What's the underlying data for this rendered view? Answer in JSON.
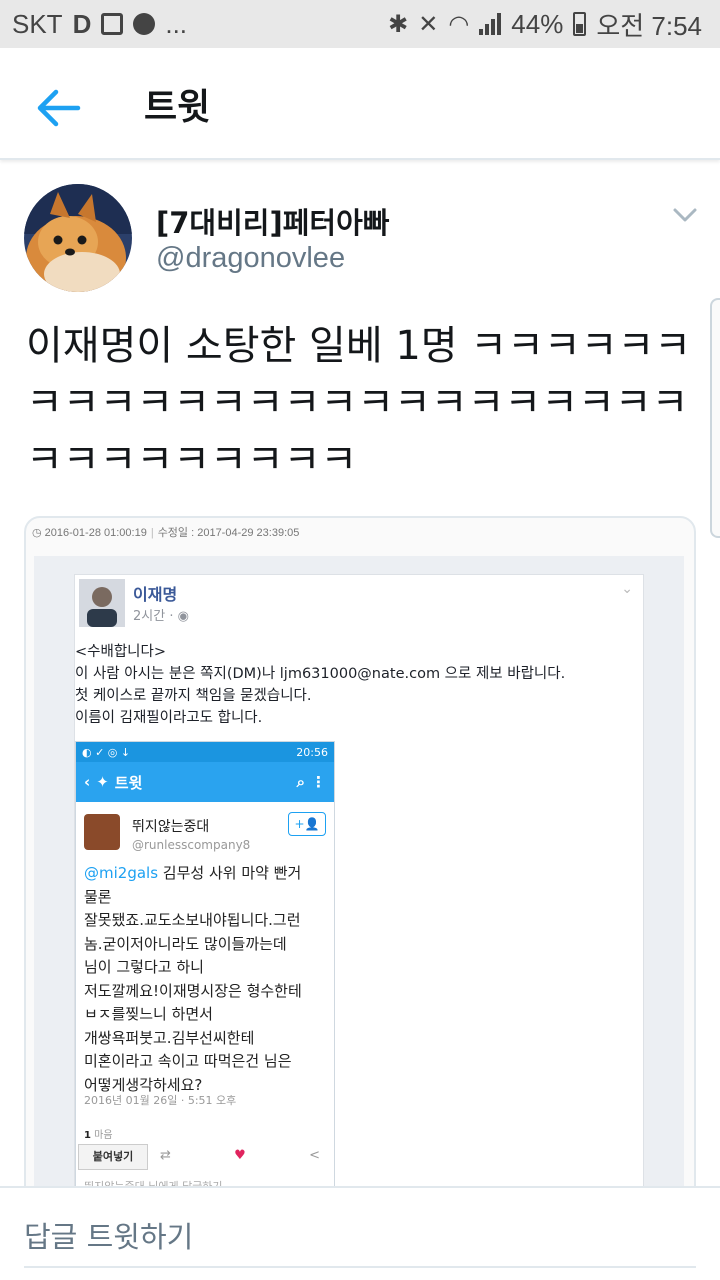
{
  "status_bar": {
    "carrier": "SKT",
    "d_icon": "D",
    "more": "...",
    "battery": "44%",
    "time": "오전 7:54",
    "icons": [
      "d-icon",
      "image-icon",
      "chat-bubble-icon",
      "bluetooth-icon",
      "vibrate-icon",
      "wifi-icon",
      "signal-icon",
      "battery-icon"
    ]
  },
  "appbar": {
    "title": "트윗"
  },
  "tweet": {
    "display_name": "[7대비리]페터아빠",
    "handle": "@dragonovlee",
    "text": "이재명이 소탕한 일베 1명 ㅋㅋㅋㅋㅋㅋㅋㅋㅋㅋㅋㅋㅋㅋㅋㅋㅋㅋㅋㅋㅋㅋㅋㅋㅋㅋㅋㅋㅋㅋㅋㅋㅋ"
  },
  "media": {
    "meta_date": "2016-01-28 01:00:19",
    "meta_modified": "수정일 : 2017-04-29 23:39:05",
    "fb_post": {
      "author": "이재명",
      "time": "2시간",
      "lines": [
        "<수배합니다>",
        "이 사람 아시는 분은 쪽지(DM)나 ljm631000@nate.com 으로 제보 바랍니다.",
        "첫 케이스로 끝까지 책임을 묻겠습니다.",
        "이름이 김재필이라고도 합니다."
      ]
    },
    "screenshot": {
      "status_time": "20:56",
      "title": "트윗",
      "name": "뛰지않는중대",
      "handle": "@runlesscompany8",
      "mention": "@mi2gals",
      "first_line_rest": " 김무성 사위 마약 빤거",
      "lines": [
        "물론",
        "잘못됐죠.교도소보내야됩니다.그런",
        "놈.굳이저아니라도 많이들까는데",
        "님이 그렇다고 하니",
        "저도깔께요!이재명시장은 형수한테",
        "ㅂㅈ를찢느니 하면서",
        "개쌍욕퍼붓고.김부선씨한테",
        "미혼이라고 속이고 따먹은건 님은",
        "어떻게생각하세요?"
      ],
      "date": "2016년 01월 26일 · 5:51 오후",
      "likes_count": "1",
      "likes_label": "마음",
      "embed_label": "붙여넣기",
      "reply_hint": "뛰지않는중대 님에게 답글하기"
    }
  },
  "reply_bar": {
    "placeholder": "답글 트윗하기"
  },
  "colors": {
    "accent": "#1da1f2",
    "text": "#14171a",
    "secondary": "#657786",
    "divider": "#e1e8ed"
  }
}
